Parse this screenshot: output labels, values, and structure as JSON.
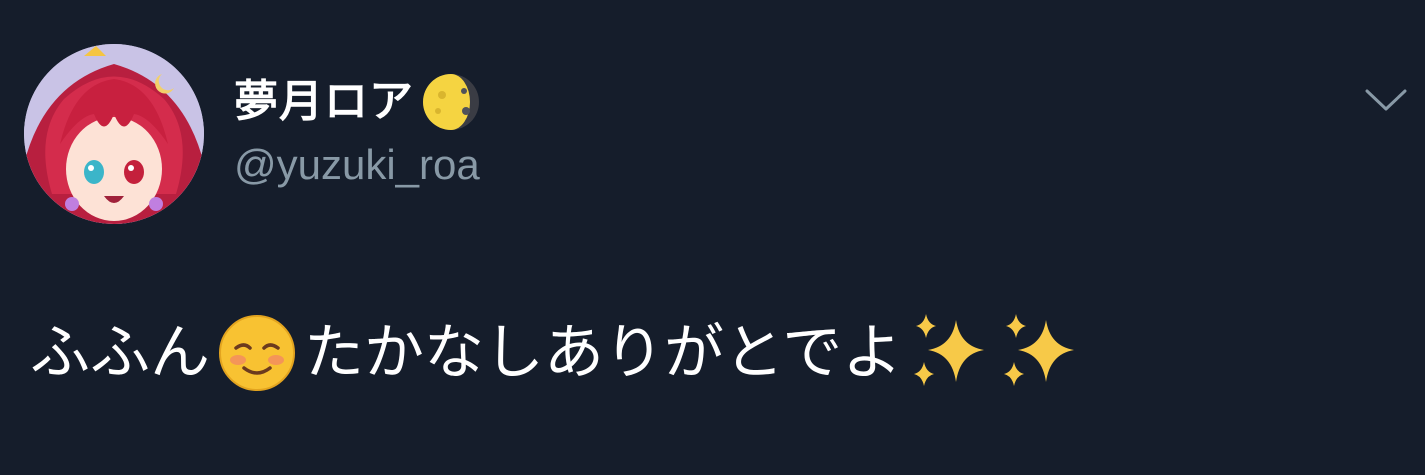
{
  "tweet": {
    "author": {
      "display_name": "夢月ロア",
      "handle": "@yuzuki_roa",
      "name_emoji_icon": "waning-moon-icon",
      "avatar_icon": "anime-avatar"
    },
    "text_part1": "ふふん",
    "emoji_1_icon": "smiling-face-icon",
    "text_part2": "たかなしありがとでよ",
    "emoji_2_icon": "sparkles-icon",
    "emoji_3_icon": "sparkles-icon",
    "menu_icon": "chevron-down-icon"
  },
  "colors": {
    "background": "#151d2b",
    "text": "#ffffff",
    "secondary_text": "#8899a6",
    "moon": "#f5d441",
    "sparkle": "#f7c948"
  }
}
